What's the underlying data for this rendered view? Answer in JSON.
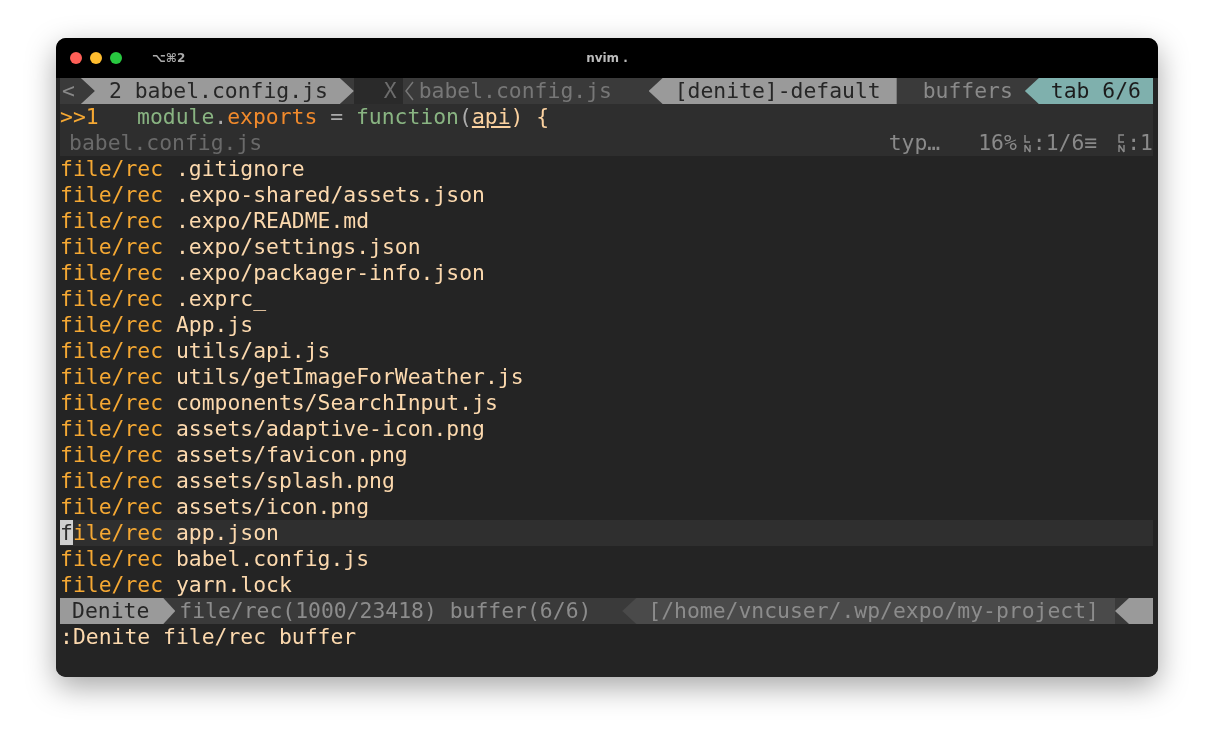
{
  "window": {
    "shortcut": "⌥⌘2",
    "title": "nvim ."
  },
  "tabline": {
    "left": [
      {
        "text": "<",
        "kind": "edge"
      },
      {
        "text": "2 babel.config.js",
        "kind": "current"
      },
      {
        "text": "X",
        "kind": "close"
      },
      {
        "text": "babel.config.js",
        "kind": "inactive"
      }
    ],
    "right": [
      {
        "text": "[denite]-default",
        "kind": "current"
      },
      {
        "text": "buffers",
        "kind": "inactive"
      },
      {
        "text": "tab 6/6",
        "kind": "accent"
      }
    ]
  },
  "code_line": {
    "number": ">>1",
    "tokens": [
      {
        "text": "module",
        "kind": "keyword"
      },
      {
        "text": ".",
        "kind": "plain"
      },
      {
        "text": "exports",
        "kind": "property"
      },
      {
        "text": " = ",
        "kind": "plain"
      },
      {
        "text": "function",
        "kind": "keyword"
      },
      {
        "text": "(",
        "kind": "plain"
      },
      {
        "text": "api",
        "kind": "param"
      },
      {
        "text": ") {",
        "kind": "brace"
      }
    ]
  },
  "winbar": {
    "file": "babel.config.js",
    "filetype": "typ…",
    "percent": "16%",
    "line": ":1/6≡",
    "column": ":1"
  },
  "rows": [
    {
      "source": "file/rec",
      "path": ".gitignore",
      "selected": false
    },
    {
      "source": "file/rec",
      "path": ".expo-shared/assets.json",
      "selected": false
    },
    {
      "source": "file/rec",
      "path": ".expo/README.md",
      "selected": false
    },
    {
      "source": "file/rec",
      "path": ".expo/settings.json",
      "selected": false
    },
    {
      "source": "file/rec",
      "path": ".expo/packager-info.json",
      "selected": false
    },
    {
      "source": "file/rec",
      "path": ".exprc_",
      "selected": false
    },
    {
      "source": "file/rec",
      "path": "App.js",
      "selected": false
    },
    {
      "source": "file/rec",
      "path": "utils/api.js",
      "selected": false
    },
    {
      "source": "file/rec",
      "path": "utils/getImageForWeather.js",
      "selected": false
    },
    {
      "source": "file/rec",
      "path": "components/SearchInput.js",
      "selected": false
    },
    {
      "source": "file/rec",
      "path": "assets/adaptive-icon.png",
      "selected": false
    },
    {
      "source": "file/rec",
      "path": "assets/favicon.png",
      "selected": false
    },
    {
      "source": "file/rec",
      "path": "assets/splash.png",
      "selected": false
    },
    {
      "source": "file/rec",
      "path": "assets/icon.png",
      "selected": false
    },
    {
      "source": "file/rec",
      "path": "app.json",
      "selected": true
    },
    {
      "source": "file/rec",
      "path": "babel.config.js",
      "selected": false
    },
    {
      "source": "file/rec",
      "path": "yarn.lock",
      "selected": false
    }
  ],
  "statusline": {
    "mode": "Denite",
    "sources": "file/rec(1000/23418) buffer(6/6)",
    "path": "[/home/vncuser/.wp/expo/my-project]"
  },
  "command_line": ":Denite file/rec buffer"
}
